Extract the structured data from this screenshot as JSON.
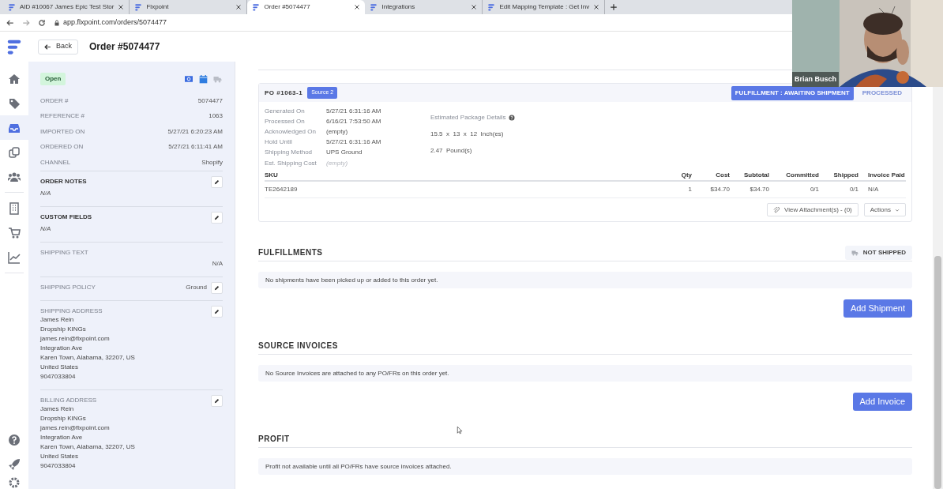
{
  "browser": {
    "tabs": [
      {
        "title": "AID #10067 James Epic Test Stor",
        "selected": false
      },
      {
        "title": "Flxpoint",
        "selected": false
      },
      {
        "title": "Order #5074477",
        "selected": true
      },
      {
        "title": "Integrations",
        "selected": false
      },
      {
        "title": "Edit Mapping Template : Get Inv",
        "selected": false
      }
    ],
    "url": "app.flxpoint.com/orders/5074477"
  },
  "nav_items": [
    {
      "kind": "home",
      "selected": false
    },
    {
      "kind": "tag",
      "selected": false
    },
    {
      "kind": "inbox",
      "selected": true
    },
    {
      "kind": "copy",
      "selected": false
    },
    {
      "kind": "users",
      "selected": false
    },
    {
      "kind": "building",
      "selected": false
    },
    {
      "kind": "cart",
      "selected": false
    },
    {
      "kind": "chart",
      "selected": false
    }
  ],
  "nav_bottom": [
    {
      "kind": "help"
    },
    {
      "kind": "rocket"
    },
    {
      "kind": "gear"
    }
  ],
  "header": {
    "back": "Back",
    "title": "Order #5074477"
  },
  "order": {
    "status": "Open",
    "fields": [
      {
        "label": "ORDER #",
        "value": "5074477"
      },
      {
        "label": "REFERENCE #",
        "value": "1063"
      },
      {
        "label": "IMPORTED ON",
        "value": "5/27/21 6:20:23 AM"
      },
      {
        "label": "ORDERED ON",
        "value": "5/27/21 6:11:41 AM"
      },
      {
        "label": "CHANNEL",
        "value": "Shopify"
      }
    ],
    "sections": [
      {
        "kind": "note",
        "label": "ORDER NOTES",
        "value": "N/A",
        "editable": true
      },
      {
        "kind": "note",
        "label": "CUSTOM FIELDS",
        "value": "N/A",
        "editable": true
      },
      {
        "kind": "text",
        "label": "SHIPPING TEXT",
        "value": "N/A",
        "editable": false
      },
      {
        "kind": "inline",
        "label": "SHIPPING POLICY",
        "value": "Ground",
        "editable": true
      },
      {
        "kind": "address",
        "label": "SHIPPING ADDRESS",
        "lines": [
          "James Rein",
          "Dropship KINGs",
          "james.rein@flxpoint.com",
          "Integration Ave",
          "Karen Town, Alabama, 32207, US",
          "United States",
          "9047033804"
        ],
        "editable": true
      },
      {
        "kind": "address",
        "label": "BILLING ADDRESS",
        "lines": [
          "James Rein",
          "Dropship KINGs",
          "james.rein@flxpoint.com",
          "Integration Ave",
          "Karen Town, Alabama, 32207, US",
          "United States",
          "9047033804"
        ],
        "editable": true
      }
    ]
  },
  "purchase_order": {
    "id": "PO #1063-1",
    "source": "Source 2",
    "badges": [
      {
        "text": "FULFILLMENT : AWAITING SHIPMENT",
        "kind": "filled"
      },
      {
        "text": "PROCESSED",
        "kind": "plain"
      }
    ],
    "details": [
      {
        "label": "Generated On",
        "value": "5/27/21 6:31:16 AM",
        "muted": false
      },
      {
        "label": "Processed On",
        "value": "6/16/21 7:53:50 AM",
        "muted": false
      },
      {
        "label": "Acknowledged On",
        "value": "(empty)",
        "muted": false
      },
      {
        "label": "Hold Until",
        "value": "5/27/21 6:31:16 AM",
        "muted": false
      },
      {
        "label": "Shipping Method",
        "value": "UPS Ground",
        "muted": false
      },
      {
        "label": "Est. Shipping Cost",
        "value": "(empty)",
        "muted": true
      }
    ],
    "package": {
      "title": "Estimated Package Details",
      "dimensions": "15.5  x  13  x  12  Inch(es)",
      "weight": "2.47  Pound(s)"
    },
    "columns": [
      "SKU",
      "Qty",
      "Cost",
      "Subtotal",
      "Committed",
      "Shipped",
      "Invoice Paid"
    ],
    "rows": [
      [
        "TE2642189",
        "1",
        "$34.70",
        "$34.70",
        "0/1",
        "0/1",
        "N/A"
      ]
    ],
    "attachments": "View Attachment(s) - (0)",
    "actions": "Actions"
  },
  "sections": [
    {
      "title": "FULFILLMENTS",
      "status": "NOT SHIPPED",
      "message": "No shipments have been picked up or added to this order yet.",
      "button": "Add Shipment"
    },
    {
      "title": "SOURCE INVOICES",
      "message": "No Source Invoices are attached to any PO/FRs on this order yet.",
      "button": "Add Invoice"
    },
    {
      "title": "PROFIT",
      "message": "Profit not available until all PO/FRs have source invoices attached."
    }
  ],
  "video": {
    "name": "Brian Busch"
  }
}
